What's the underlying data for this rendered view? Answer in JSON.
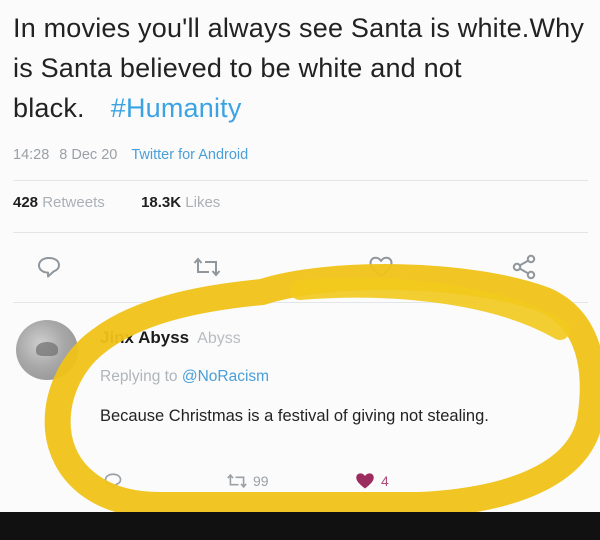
{
  "tweet": {
    "text": "In movies you'll always see Santa is white.Why is Santa believed to be white and not black.",
    "hashtag": "#Humanity",
    "time": "14:28",
    "date": "8 Dec 20",
    "via": "Twitter for Android",
    "retweets_count": "428",
    "retweets_label": "Retweets",
    "likes_count": "18.3K",
    "likes_label": "Likes"
  },
  "actions": {
    "reply_icon": "reply-icon",
    "retweet_icon": "retweet-icon",
    "like_icon": "heart-icon",
    "share_icon": "share-icon"
  },
  "reply": {
    "name": "Jinx Abyss",
    "handle": "Abyss",
    "replying_prefix": "Replying to",
    "replying_to": "@NoRacism",
    "body": "Because Christmas is a festival of giving not stealing.",
    "retweet_count": "99",
    "like_count": "4"
  },
  "colors": {
    "link": "#4a9fd8",
    "hashtag": "#3aa3e3",
    "muted": "#9aa0a6",
    "highlight": "#f0c318",
    "liked_heart": "#9c2c5e"
  }
}
